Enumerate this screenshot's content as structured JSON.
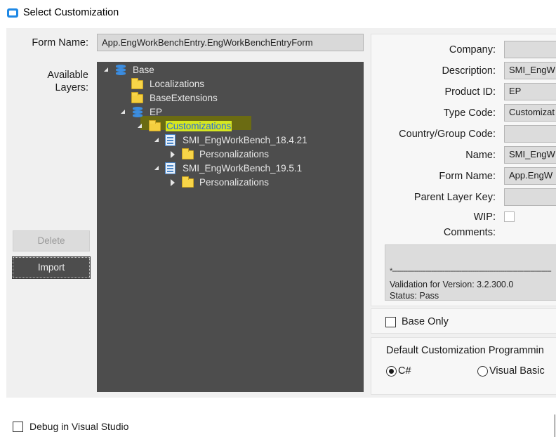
{
  "window": {
    "title": "Select Customization",
    "icon": "app-window-icon"
  },
  "form": {
    "form_name_label": "Form Name:",
    "form_name_value": "App.EngWorkBenchEntry.EngWorkBenchEntryForm",
    "available_layers_label_line1": "Available",
    "available_layers_label_line2": "Layers:"
  },
  "tree": {
    "nodes": [
      {
        "label": "Base",
        "icon": "database-icon",
        "expanded": true
      },
      {
        "label": "Localizations",
        "icon": "folder-icon"
      },
      {
        "label": "BaseExtensions",
        "icon": "folder-open-icon"
      },
      {
        "label": "EP",
        "icon": "database-icon",
        "expanded": true
      },
      {
        "label": "Customizations",
        "icon": "folder-open-icon",
        "expanded": true,
        "selected": true
      },
      {
        "label": "SMI_EngWorkBench_18.4.21",
        "icon": "document-icon",
        "expanded": true
      },
      {
        "label": "Personalizations",
        "icon": "folder-icon",
        "expanded": false
      },
      {
        "label": "SMI_EngWorkBench_19.5.1",
        "icon": "document-icon",
        "expanded": true
      },
      {
        "label": "Personalizations",
        "icon": "folder-icon",
        "expanded": false
      }
    ]
  },
  "buttons": {
    "delete": "Delete",
    "import": "Import"
  },
  "details": {
    "company_label": "Company:",
    "company_value": "",
    "description_label": "Description:",
    "description_value": "SMI_EngW",
    "product_id_label": "Product ID:",
    "product_id_value": "EP",
    "type_code_label": "Type Code:",
    "type_code_value": "Customizat",
    "country_group_label": "Country/Group Code:",
    "country_group_value": "",
    "name_label": "Name:",
    "name_value": "SMI_EngW",
    "form_name_label": "Form Name:",
    "form_name_value": "App.EngW",
    "parent_layer_label": "Parent Layer Key:",
    "parent_layer_value": "",
    "wip_label": "WIP:",
    "wip_checked": false,
    "comments_label": "Comments:",
    "comments_dashes": "*-------------------------------------------------------------------------------------",
    "comments_line1": "Validation for Version: 3.2.300.0",
    "comments_line2": "Status: Pass"
  },
  "options": {
    "base_only_label": "Base Only",
    "base_only_checked": false,
    "language_heading": "Default Customization Programmin",
    "csharp_label": "C#",
    "csharp_selected": true,
    "vb_label": "Visual Basic",
    "vb_selected": false
  },
  "footer": {
    "debug_label": "Debug in Visual Studio",
    "debug_checked": false
  }
}
